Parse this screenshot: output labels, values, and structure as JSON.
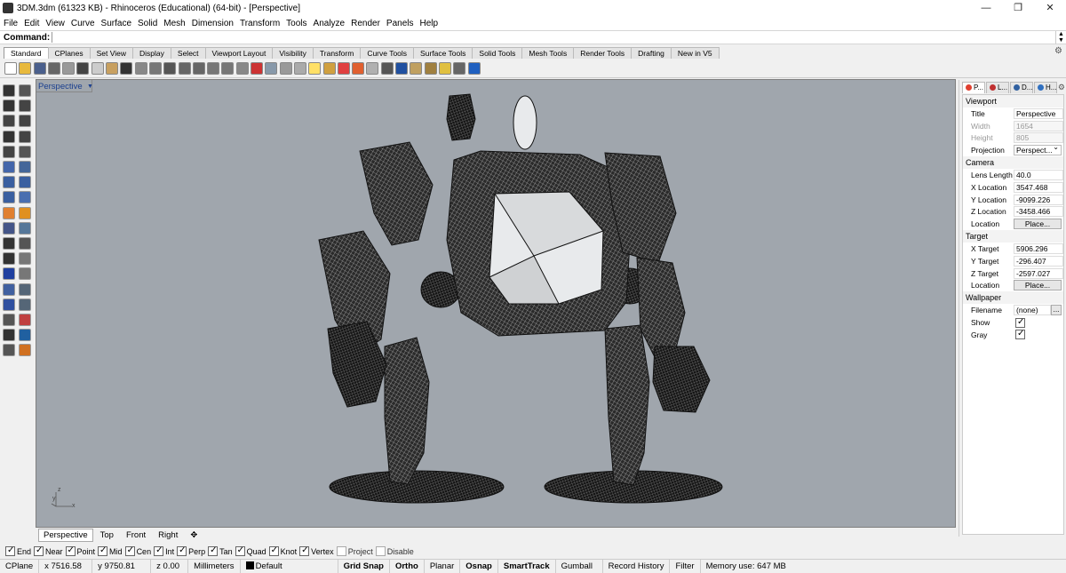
{
  "window": {
    "title": "3DM.3dm (61323 KB) - Rhinoceros (Educational) (64-bit) - [Perspective]",
    "minimize": "—",
    "maximize": "❐",
    "close": "✕"
  },
  "menu": [
    "File",
    "Edit",
    "View",
    "Curve",
    "Surface",
    "Solid",
    "Mesh",
    "Dimension",
    "Transform",
    "Tools",
    "Analyze",
    "Render",
    "Panels",
    "Help"
  ],
  "command": {
    "label": "Command:",
    "value": ""
  },
  "toolbar_tabs": [
    "Standard",
    "CPlanes",
    "Set View",
    "Display",
    "Select",
    "Viewport Layout",
    "Visibility",
    "Transform",
    "Curve Tools",
    "Surface Tools",
    "Solid Tools",
    "Mesh Tools",
    "Render Tools",
    "Drafting",
    "New in V5"
  ],
  "toolbar_icons": [
    {
      "name": "new-icon",
      "color": "#ffffff"
    },
    {
      "name": "open-icon",
      "color": "#e8b93c"
    },
    {
      "name": "save-icon",
      "color": "#4a5f8c"
    },
    {
      "name": "print-icon",
      "color": "#666666"
    },
    {
      "name": "import-icon",
      "color": "#999999"
    },
    {
      "name": "cut-icon",
      "color": "#444444"
    },
    {
      "name": "copy-icon",
      "color": "#cccccc"
    },
    {
      "name": "paste-icon",
      "color": "#c8a060"
    },
    {
      "name": "undo-icon",
      "color": "#333333"
    },
    {
      "name": "pan-icon",
      "color": "#888888"
    },
    {
      "name": "move-view-icon",
      "color": "#777777"
    },
    {
      "name": "zoom-icon",
      "color": "#555555"
    },
    {
      "name": "zoom-window-icon",
      "color": "#666666"
    },
    {
      "name": "zoom-extents-icon",
      "color": "#666666"
    },
    {
      "name": "zoom-selected-icon",
      "color": "#777777"
    },
    {
      "name": "rotate-view-icon",
      "color": "#777777"
    },
    {
      "name": "grid-icon",
      "color": "#888888"
    },
    {
      "name": "car-icon",
      "color": "#cc3333"
    },
    {
      "name": "viewport-icon",
      "color": "#8899aa"
    },
    {
      "name": "select-icon",
      "color": "#999999"
    },
    {
      "name": "selection-filter-icon",
      "color": "#aaaaaa"
    },
    {
      "name": "light-icon",
      "color": "#ffe066"
    },
    {
      "name": "lock-icon",
      "color": "#d0a040"
    },
    {
      "name": "layer-icon",
      "color": "#e04040"
    },
    {
      "name": "color-wheel-icon",
      "color": "#e06030"
    },
    {
      "name": "render-sphere-icon",
      "color": "#b0b0b0"
    },
    {
      "name": "material-icon",
      "color": "#555555"
    },
    {
      "name": "environment-icon",
      "color": "#2050a0"
    },
    {
      "name": "tools-icon",
      "color": "#c0a060"
    },
    {
      "name": "options-icon",
      "color": "#a08040"
    },
    {
      "name": "extend-icon",
      "color": "#e0c040"
    },
    {
      "name": "layout-icon",
      "color": "#666666"
    },
    {
      "name": "help-icon",
      "color": "#2060c0"
    }
  ],
  "left_tool_icons": [
    {
      "name": "select-arrow-icon",
      "color": "#333333"
    },
    {
      "name": "point-icon",
      "color": "#555555"
    },
    {
      "name": "polyline-icon",
      "color": "#333333"
    },
    {
      "name": "curve-icon",
      "color": "#444444"
    },
    {
      "name": "circle-icon",
      "color": "#444444"
    },
    {
      "name": "ellipse-icon",
      "color": "#444444"
    },
    {
      "name": "polygon-icon",
      "color": "#333333"
    },
    {
      "name": "rectangle-icon",
      "color": "#444444"
    },
    {
      "name": "arc-icon",
      "color": "#444444"
    },
    {
      "name": "offset-icon",
      "color": "#555555"
    },
    {
      "name": "extrude-icon",
      "color": "#4466aa"
    },
    {
      "name": "surface-icon",
      "color": "#446699"
    },
    {
      "name": "box-icon",
      "color": "#3a5fa0"
    },
    {
      "name": "sphere-icon",
      "color": "#3a5fa0"
    },
    {
      "name": "cylinder-icon",
      "color": "#3a5fa0"
    },
    {
      "name": "cone-icon",
      "color": "#4a6fb0"
    },
    {
      "name": "boolean-icon",
      "color": "#e08030"
    },
    {
      "name": "explode-icon",
      "color": "#e09020"
    },
    {
      "name": "fillet-icon",
      "color": "#445588"
    },
    {
      "name": "mesh-icon",
      "color": "#557799"
    },
    {
      "name": "transform-icon",
      "color": "#333333"
    },
    {
      "name": "rotate-icon",
      "color": "#555555"
    },
    {
      "name": "scale-icon",
      "color": "#333333"
    },
    {
      "name": "mirror-icon",
      "color": "#777777"
    },
    {
      "name": "text-icon",
      "color": "#2040a0"
    },
    {
      "name": "dimension-icon",
      "color": "#777777"
    },
    {
      "name": "array-icon",
      "color": "#4060a0"
    },
    {
      "name": "group-icon",
      "color": "#556677"
    },
    {
      "name": "solid-tools-icon",
      "color": "#3050a0"
    },
    {
      "name": "cap-icon",
      "color": "#556677"
    },
    {
      "name": "grid-array-icon",
      "color": "#555555"
    },
    {
      "name": "analyze-icon",
      "color": "#c04040"
    },
    {
      "name": "check-icon",
      "color": "#333333"
    },
    {
      "name": "render-icon",
      "color": "#2060a0"
    },
    {
      "name": "named-view-icon",
      "color": "#555555"
    },
    {
      "name": "paint-icon",
      "color": "#d07020"
    }
  ],
  "viewport": {
    "label": "Perspective",
    "axes": {
      "z": "z",
      "y": "y",
      "x": "x"
    },
    "colors": {
      "background": "#a0a6ad",
      "wire": "#111111",
      "light": "#e8eaec"
    }
  },
  "viewport_tabs": [
    "Perspective",
    "Top",
    "Front",
    "Right",
    "✥"
  ],
  "osnaps": [
    {
      "label": "End",
      "on": true
    },
    {
      "label": "Near",
      "on": true
    },
    {
      "label": "Point",
      "on": true
    },
    {
      "label": "Mid",
      "on": true
    },
    {
      "label": "Cen",
      "on": true
    },
    {
      "label": "Int",
      "on": true
    },
    {
      "label": "Perp",
      "on": true
    },
    {
      "label": "Tan",
      "on": true
    },
    {
      "label": "Quad",
      "on": true
    },
    {
      "label": "Knot",
      "on": true
    },
    {
      "label": "Vertex",
      "on": true
    },
    {
      "label": "Project",
      "on": false
    },
    {
      "label": "Disable",
      "on": false
    }
  ],
  "status": {
    "cplane": "CPlane",
    "x": "x 7516.58",
    "y": "y 9750.81",
    "z": "z 0.00",
    "units": "Millimeters",
    "layer": "Default",
    "grid_snap": "Grid Snap",
    "ortho": "Ortho",
    "planar": "Planar",
    "osnap": "Osnap",
    "smarttrack": "SmartTrack",
    "gumball": "Gumball",
    "record_history": "Record History",
    "filter": "Filter",
    "memory": "Memory use: 647 MB"
  },
  "panel": {
    "tabs": [
      {
        "label": "P...",
        "color": "#e04030"
      },
      {
        "label": "L...",
        "color": "#c03030"
      },
      {
        "label": "D...",
        "color": "#3060a0"
      },
      {
        "label": "H...",
        "color": "#3070c0"
      }
    ],
    "viewport_section": "Viewport",
    "title_label": "Title",
    "title_value": "Perspective",
    "width_label": "Width",
    "width_value": "1654",
    "height_label": "Height",
    "height_value": "805",
    "projection_label": "Projection",
    "projection_value": "Perspect...",
    "camera_section": "Camera",
    "lens_label": "Lens Length",
    "lens_value": "40.0",
    "xloc_label": "X Location",
    "xloc_value": "3547.468",
    "yloc_label": "Y Location",
    "yloc_value": "-9099.226",
    "zloc_label": "Z Location",
    "zloc_value": "-3458.466",
    "loc_label": "Location",
    "place_label": "Place...",
    "target_section": "Target",
    "xt_label": "X Target",
    "xt_value": "5906.296",
    "yt_label": "Y Target",
    "yt_value": "-296.407",
    "zt_label": "Z Target",
    "zt_value": "-2597.027",
    "tloc_label": "Location",
    "tplace_label": "Place...",
    "wallpaper_section": "Wallpaper",
    "filename_label": "Filename",
    "filename_value": "(none)",
    "ellipsis": "...",
    "show_label": "Show",
    "gray_label": "Gray"
  }
}
